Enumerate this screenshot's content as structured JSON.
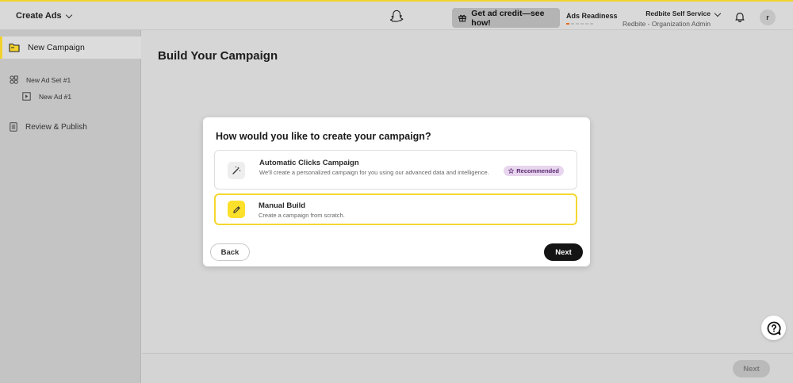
{
  "topbar": {
    "menu_label": "Create Ads",
    "credit_label": "Get ad credit—see how!",
    "readiness_label": "Ads Readiness",
    "account_name": "Redbite Self Service",
    "account_role": "Redbite - Organization Admin",
    "avatar_initial": "r"
  },
  "sidebar": {
    "items": [
      {
        "label": "New Campaign",
        "icon": "folder-icon"
      },
      {
        "label": "New Ad Set #1",
        "icon": "adset-icon"
      },
      {
        "label": "New Ad #1",
        "icon": "ad-icon"
      },
      {
        "label": "Review & Publish",
        "icon": "review-icon"
      }
    ]
  },
  "main": {
    "heading": "Build Your Campaign"
  },
  "modal": {
    "title": "How would you like to create your campaign?",
    "options": [
      {
        "title": "Automatic Clicks Campaign",
        "description": "We'll create a personalized campaign for you using our advanced data and intelligence.",
        "badge": "Recommended",
        "icon": "magic-wand-icon"
      },
      {
        "title": "Manual Build",
        "description": "Create a campaign from scratch.",
        "icon": "pencil-icon",
        "selected": true
      }
    ],
    "back_label": "Back",
    "next_label": "Next"
  },
  "footer": {
    "next_label": "Next"
  },
  "colors": {
    "accent": "#f5d72f",
    "badge_bg": "#e8d5ee",
    "badge_text": "#5b2a73",
    "primary_button": "#141414"
  }
}
